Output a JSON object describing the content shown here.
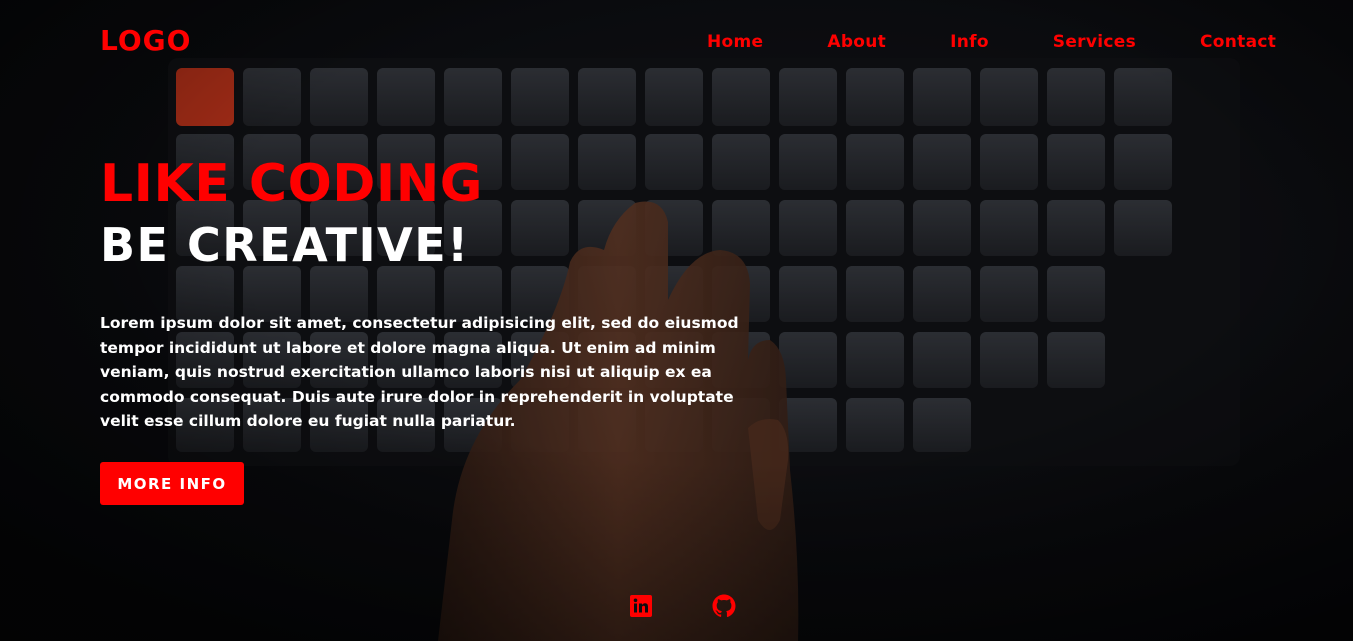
{
  "brand": {
    "logo": "LOGO",
    "accent": "#ff0000"
  },
  "nav": {
    "items": [
      {
        "label": "Home"
      },
      {
        "label": "About"
      },
      {
        "label": "Info"
      },
      {
        "label": "Services"
      },
      {
        "label": "Contact"
      }
    ]
  },
  "hero": {
    "headline_primary": "LIKE CODING",
    "headline_secondary": "BE CREATIVE!",
    "body": "Lorem ipsum dolor sit amet, consectetur adipisicing elit, sed do eiusmod tempor incididunt ut labore et dolore magna aliqua. Ut enim ad minim veniam, quis nostrud exercitation ullamco laboris nisi ut aliquip ex ea commodo consequat. Duis aute irure dolor in reprehenderit in voluptate velit esse cillum dolore eu fugiat nulla pariatur.",
    "cta_label": "MORE INFO"
  },
  "social": {
    "items": [
      {
        "icon": "linkedin-icon"
      },
      {
        "icon": "github-icon"
      }
    ]
  }
}
